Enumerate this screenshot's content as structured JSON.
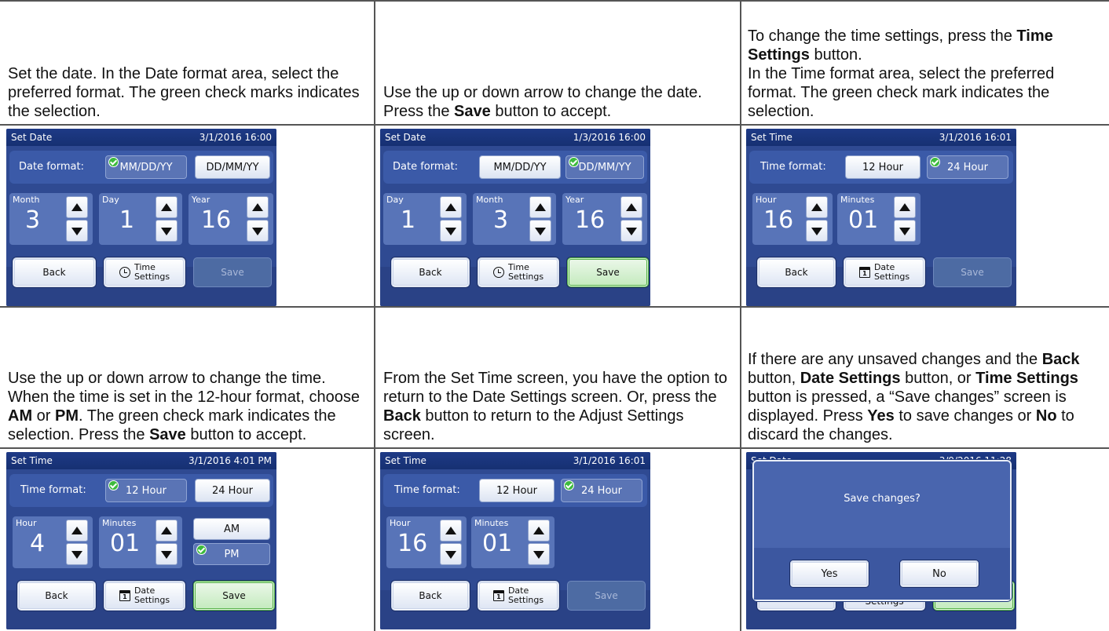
{
  "cells": {
    "c1": {
      "text": "Set the date. In the Date format area, select the preferred format. The green check marks indicates the selection."
    },
    "c2": {
      "pre": "Use the up or down arrow to change the date. Press the ",
      "b1": "Save",
      "post": " button to accept."
    },
    "c3": {
      "l1": "To change the time settings, press the ",
      "b1": "Time Settings",
      "l2": " button.",
      "l3": "In the Time format area, select the preferred format. The green check mark indicates the selection."
    },
    "c4": {
      "p1": "Use the up or down arrow to change the time. When the time is set in the 12-hour format, choose ",
      "b1": "AM",
      "p2": " or ",
      "b2": "PM",
      "p3": ". The green check mark indicates the selection. Press the ",
      "b3": "Save",
      "p4": " button to accept."
    },
    "c5": {
      "p1": "From the Set Time screen, you have the option to return to the Date Settings screen. Or, press the ",
      "b1": "Back",
      "p2": " button to return to the Adjust Settings screen."
    },
    "c6": {
      "p1": "If there are any unsaved changes and the ",
      "b1": "Back",
      "p2": " button, ",
      "b2": "Date Settings",
      "p3": " button, or ",
      "b3": "Time Settings",
      "p4": " button is pressed, a “Save changes” screen is displayed. Press ",
      "b4": "Yes",
      "p5": " to save changes or ",
      "b5": "No",
      "p6": " to discard the changes."
    }
  },
  "screens": {
    "s1": {
      "title": "Set Date",
      "datetime": "3/1/2016 16:00",
      "fmt_label": "Date format:",
      "opt1": "MM/DD/YY",
      "opt2": "DD/MM/YY",
      "f1": "Month",
      "v1": "3",
      "f2": "Day",
      "v2": "1",
      "f3": "Year",
      "v3": "16",
      "back": "Back",
      "mid1": "Time",
      "mid2": "Settings",
      "save": "Save"
    },
    "s2": {
      "title": "Set Date",
      "datetime": "1/3/2016 16:00",
      "fmt_label": "Date format:",
      "opt1": "MM/DD/YY",
      "opt2": "DD/MM/YY",
      "f1": "Day",
      "v1": "1",
      "f2": "Month",
      "v2": "3",
      "f3": "Year",
      "v3": "16",
      "back": "Back",
      "mid1": "Time",
      "mid2": "Settings",
      "save": "Save"
    },
    "s3": {
      "title": "Set Time",
      "datetime": "3/1/2016 16:01",
      "fmt_label": "Time format:",
      "opt1": "12 Hour",
      "opt2": "24 Hour",
      "f1": "Hour",
      "v1": "16",
      "f2": "Minutes",
      "v2": "01",
      "back": "Back",
      "mid1": "Date",
      "mid2": "Settings",
      "save": "Save",
      "cal_day": "1"
    },
    "s4": {
      "title": "Set Time",
      "datetime": "3/1/2016 4:01 PM",
      "fmt_label": "Time format:",
      "opt1": "12 Hour",
      "opt2": "24 Hour",
      "f1": "Hour",
      "v1": "4",
      "f2": "Minutes",
      "v2": "01",
      "am": "AM",
      "pm": "PM",
      "back": "Back",
      "mid1": "Date",
      "mid2": "Settings",
      "save": "Save",
      "cal_day": "1"
    },
    "s5": {
      "title": "Set Time",
      "datetime": "3/1/2016 16:01",
      "fmt_label": "Time format:",
      "opt1": "12 Hour",
      "opt2": "24 Hour",
      "f1": "Hour",
      "v1": "16",
      "f2": "Minutes",
      "v2": "01",
      "back": "Back",
      "mid1": "Date",
      "mid2": "Settings",
      "save": "Save",
      "cal_day": "1"
    },
    "s6": {
      "title": "Set Date",
      "datetime": "3/9/2016 11:28",
      "message": "Save changes?",
      "yes": "Yes",
      "no": "No",
      "under_label": "Settings"
    }
  }
}
